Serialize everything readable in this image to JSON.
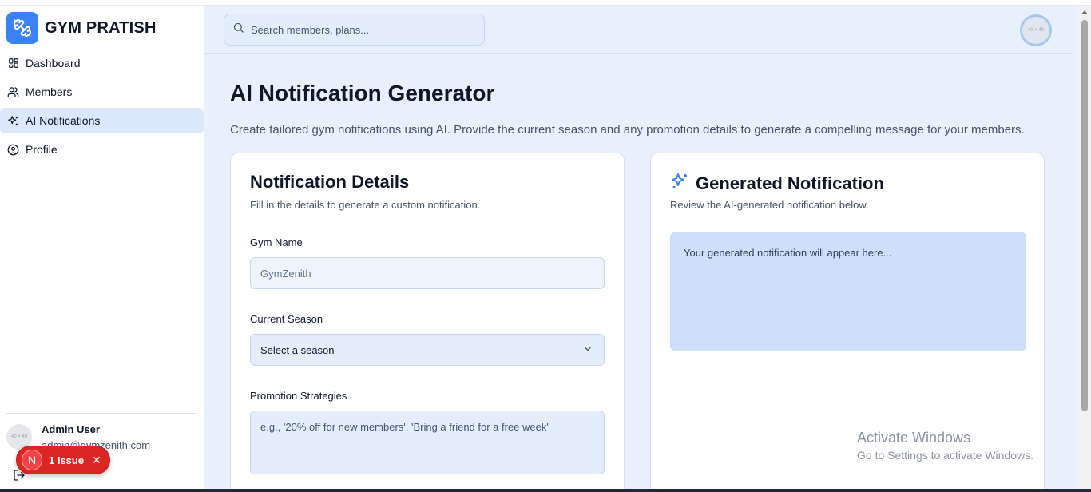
{
  "brand": {
    "name": "GYM PRATISH"
  },
  "nav": {
    "items": [
      {
        "label": "Dashboard",
        "icon": "dashboard-icon"
      },
      {
        "label": "Members",
        "icon": "users-icon"
      },
      {
        "label": "AI Notifications",
        "icon": "sparkles-icon",
        "active": true
      },
      {
        "label": "Profile",
        "icon": "user-circle-icon"
      }
    ]
  },
  "user": {
    "name": "Admin User",
    "email": "admin@gymzenith.com",
    "avatar_text": "40 × 40"
  },
  "issue_badge": {
    "letter": "N",
    "text": "1 Issue"
  },
  "header": {
    "search_placeholder": "Search members, plans...",
    "avatar_text": "40 × 40"
  },
  "page": {
    "title": "AI Notification Generator",
    "subtitle": "Create tailored gym notifications using AI. Provide the current season and any promotion details to generate a compelling message for your members."
  },
  "details_card": {
    "title": "Notification Details",
    "subtitle": "Fill in the details to generate a custom notification.",
    "gym_name_label": "Gym Name",
    "gym_name_value": "GymZenith",
    "season_label": "Current Season",
    "season_value": "Select a season",
    "promotion_label": "Promotion Strategies",
    "promotion_placeholder": "e.g., '20% off for new members', 'Bring a friend for a free week'"
  },
  "output_card": {
    "title": "Generated Notification",
    "subtitle": "Review the AI-generated notification below.",
    "placeholder": "Your generated notification will appear here..."
  },
  "watermark": {
    "title": "Activate Windows",
    "subtitle": "Go to Settings to activate Windows."
  },
  "colors": {
    "accent": "#3b82f6",
    "main_bg": "#e8f0fc",
    "active_nav": "#dbe8fb",
    "issue_red": "#dc2626"
  }
}
